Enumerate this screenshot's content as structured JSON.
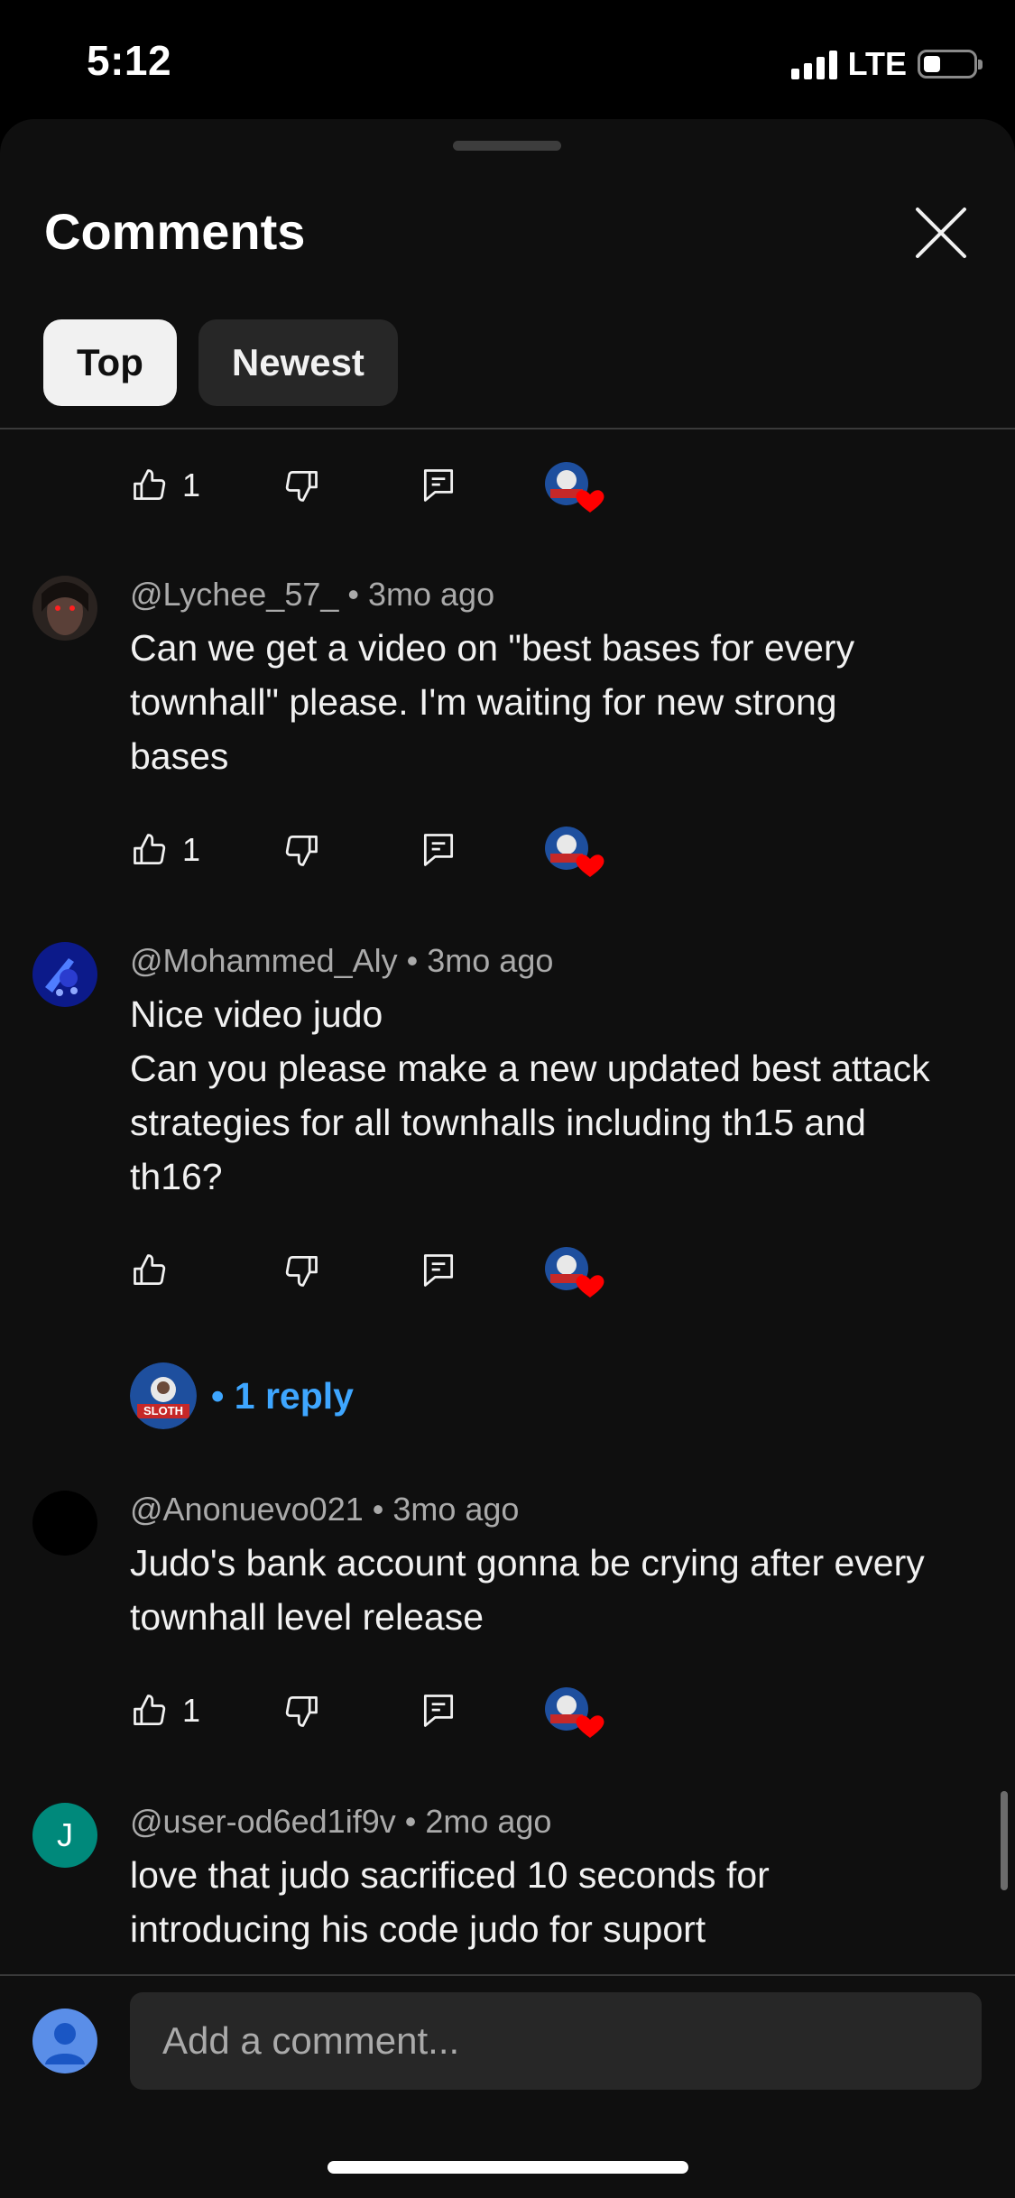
{
  "status_bar": {
    "time": "5:12",
    "network": "LTE"
  },
  "sheet": {
    "title": "Comments",
    "tabs": [
      {
        "label": "Top",
        "active": true
      },
      {
        "label": "Newest",
        "active": false
      }
    ]
  },
  "partial_actions": {
    "like_count": "1"
  },
  "comments": [
    {
      "author": "@Lychee_57_",
      "separator": "•",
      "time": "3mo ago",
      "text": "Can we get a video on \"best bases for every townhall\" please. I'm waiting for new strong bases",
      "like_count": "1"
    },
    {
      "author": "@Mohammed_Aly",
      "separator": "•",
      "time": "3mo ago",
      "text_line1": "Nice video judo",
      "text_line2": "Can you please make a new updated best attack strategies for all townhalls including th15 and th16?",
      "like_count": "",
      "reply_label": "• 1 reply"
    },
    {
      "author": "@Anonuevo021",
      "separator": "•",
      "time": "3mo ago",
      "text": "Judo's bank account gonna be crying after every townhall level release",
      "like_count": "1"
    },
    {
      "author": "@user-od6ed1if9v",
      "separator": "•",
      "time": "2mo ago",
      "text": "love that judo sacrificed 10 seconds for introducing his code judo for suport",
      "avatar_letter": "J"
    }
  ],
  "creator_badge": {
    "text": "SLOTH"
  },
  "composer": {
    "placeholder": "Add a comment..."
  },
  "colors": {
    "accent": "#3ea6ff",
    "heart": "#ff0000",
    "sheet_bg": "#0f0f0f",
    "teal_avatar": "#00897b"
  }
}
